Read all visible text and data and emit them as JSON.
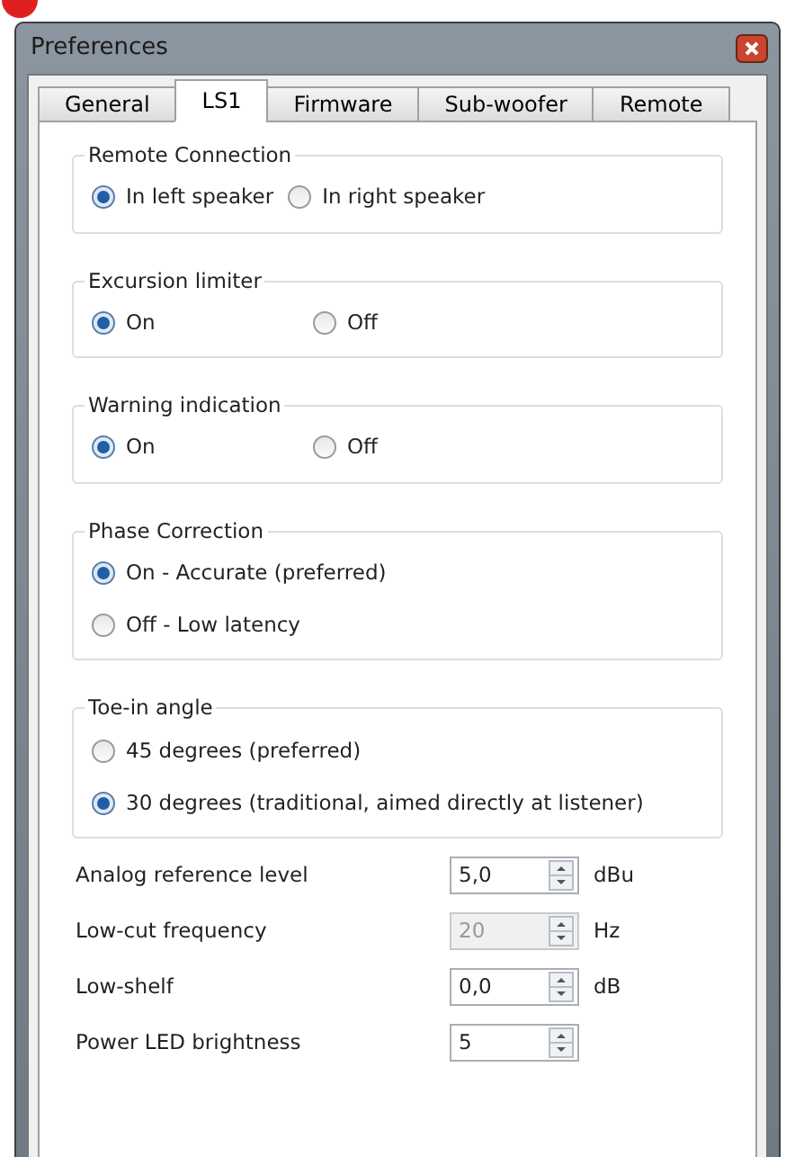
{
  "window": {
    "title": "Preferences"
  },
  "tabs": [
    {
      "label": "General",
      "selected": false
    },
    {
      "label": "LS1",
      "selected": true
    },
    {
      "label": "Firmware",
      "selected": false
    },
    {
      "label": "Sub-woofer",
      "selected": false
    },
    {
      "label": "Remote",
      "selected": false
    }
  ],
  "groups": [
    {
      "title": "Remote Connection",
      "kind": "row",
      "options": [
        {
          "label": "In left speaker",
          "selected": true
        },
        {
          "label": "In right speaker",
          "selected": false
        }
      ]
    },
    {
      "title": "Excursion limiter",
      "kind": "columns",
      "options": [
        {
          "label": "On",
          "selected": true
        },
        {
          "label": "Off",
          "selected": false
        }
      ]
    },
    {
      "title": "Warning indication",
      "kind": "columns",
      "options": [
        {
          "label": "On",
          "selected": true
        },
        {
          "label": "Off",
          "selected": false
        }
      ]
    },
    {
      "title": "Phase Correction",
      "kind": "stack",
      "options": [
        {
          "label": "On - Accurate (preferred)",
          "selected": true
        },
        {
          "label": "Off - Low latency",
          "selected": false
        }
      ]
    },
    {
      "title": "Toe-in angle",
      "kind": "stack",
      "options": [
        {
          "label": "45 degrees (preferred)",
          "selected": false
        },
        {
          "label": "30 degrees (traditional, aimed directly at listener)",
          "selected": true
        }
      ]
    }
  ],
  "fields": [
    {
      "label": "Analog reference level",
      "value": "5,0",
      "unit": "dBu",
      "disabled": false
    },
    {
      "label": "Low-cut frequency",
      "value": "20",
      "unit": "Hz",
      "disabled": true
    },
    {
      "label": "Low-shelf",
      "value": "0,0",
      "unit": "dB",
      "disabled": false
    },
    {
      "label": "Power LED brightness",
      "value": "5",
      "disabled": false
    }
  ]
}
